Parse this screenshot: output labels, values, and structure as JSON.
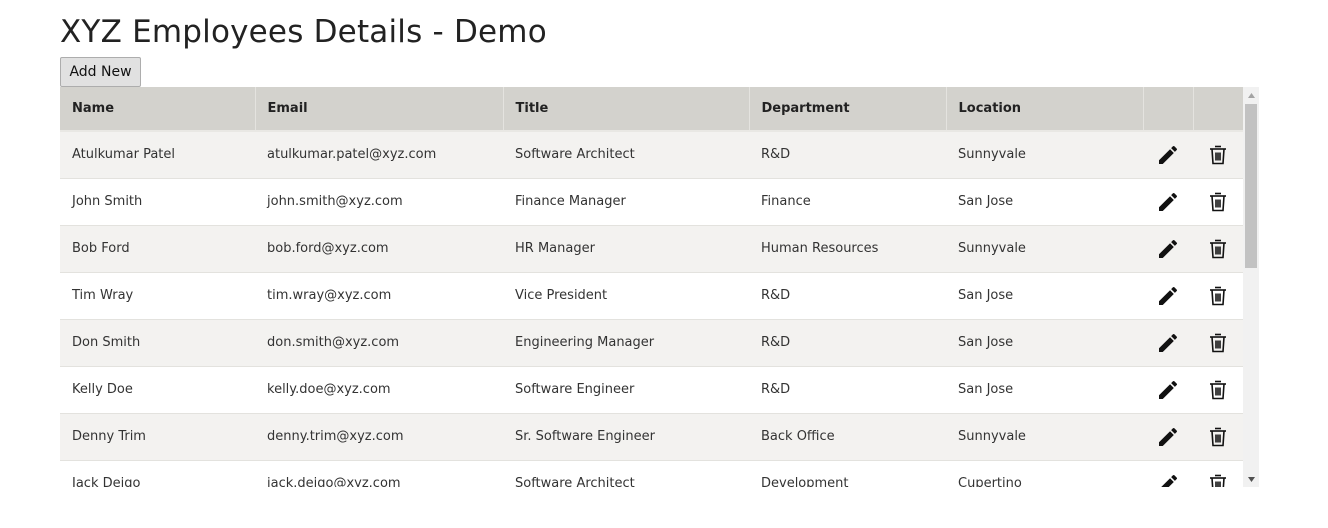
{
  "page": {
    "title": "XYZ Employees Details - Demo",
    "add_button_label": "Add New"
  },
  "grid": {
    "columns": [
      "Name",
      "Email",
      "Title",
      "Department",
      "Location",
      "",
      ""
    ],
    "rows": [
      {
        "name": "Atulkumar Patel",
        "email": "atulkumar.patel@xyz.com",
        "title": "Software Architect",
        "department": "R&D",
        "location": "Sunnyvale"
      },
      {
        "name": "John Smith",
        "email": "john.smith@xyz.com",
        "title": "Finance Manager",
        "department": "Finance",
        "location": "San Jose"
      },
      {
        "name": "Bob Ford",
        "email": "bob.ford@xyz.com",
        "title": "HR Manager",
        "department": "Human Resources",
        "location": "Sunnyvale"
      },
      {
        "name": "Tim Wray",
        "email": "tim.wray@xyz.com",
        "title": "Vice President",
        "department": "R&D",
        "location": "San Jose"
      },
      {
        "name": "Don Smith",
        "email": "don.smith@xyz.com",
        "title": "Engineering Manager",
        "department": "R&D",
        "location": "San Jose"
      },
      {
        "name": "Kelly Doe",
        "email": "kelly.doe@xyz.com",
        "title": "Software Engineer",
        "department": "R&D",
        "location": "San Jose"
      },
      {
        "name": "Denny Trim",
        "email": "denny.trim@xyz.com",
        "title": "Sr. Software Engineer",
        "department": "Back Office",
        "location": "Sunnyvale"
      },
      {
        "name": "Jack Deigo",
        "email": "jack.deigo@xyz.com",
        "title": "Software Architect",
        "department": "Development",
        "location": "Cupertino"
      }
    ],
    "row_icons": {
      "edit": "pencil-icon",
      "delete": "trash-icon"
    }
  },
  "colors": {
    "header_bg": "#d3d2cd",
    "row_alt_bg": "#f3f2f0",
    "icon": "#111111"
  }
}
